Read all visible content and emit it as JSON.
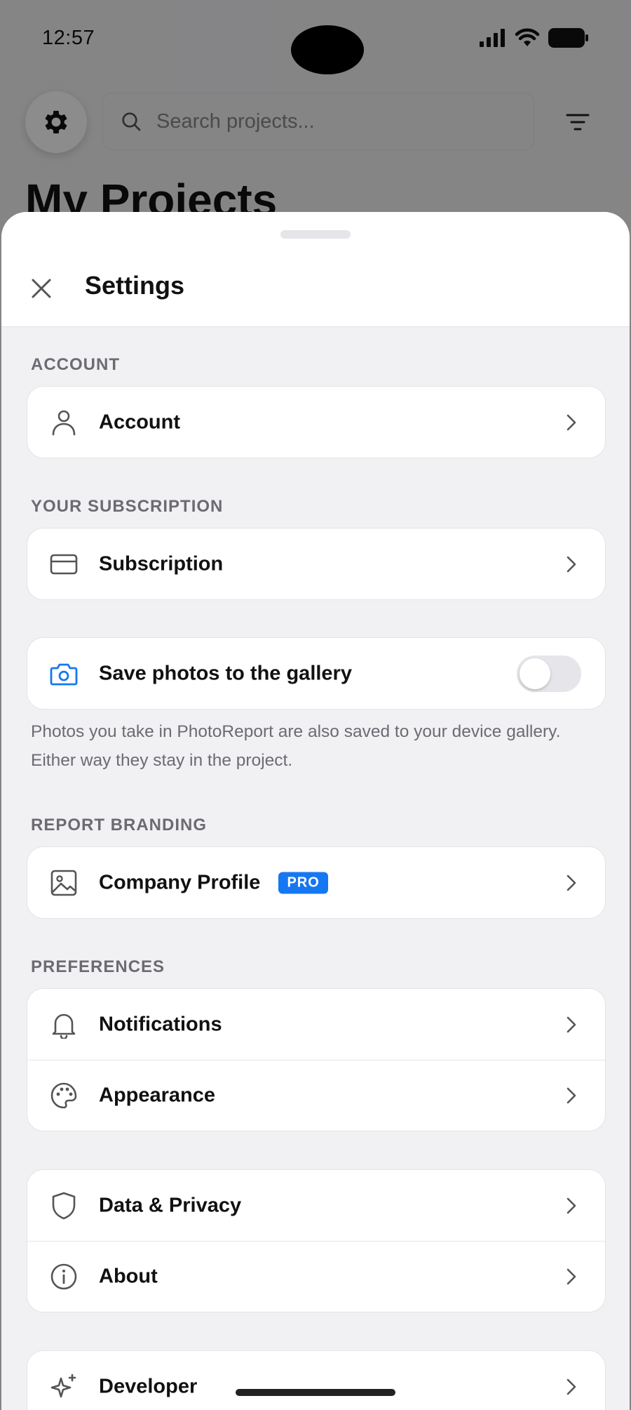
{
  "status_bar": {
    "time": "12:57"
  },
  "background": {
    "search_placeholder": "Search projects...",
    "title": "My Projects"
  },
  "sheet": {
    "title": "Settings",
    "sections": {
      "account_label": "ACCOUNT",
      "subscription_label": "YOUR SUBSCRIPTION",
      "branding_label": "REPORT BRANDING",
      "preferences_label": "PREFERENCES"
    },
    "rows": {
      "account": "Account",
      "subscription": "Subscription",
      "save_photos": "Save photos to the gallery",
      "company_profile": "Company Profile",
      "pro_badge": "PRO",
      "notifications": "Notifications",
      "appearance": "Appearance",
      "data_privacy": "Data & Privacy",
      "about": "About",
      "developer": "Developer"
    },
    "save_photos_enabled": false,
    "save_photos_helper": "Photos you take in PhotoReport are also saved to your device gallery. Either way they stay in the project."
  },
  "colors": {
    "accent": "#1677f2",
    "toggle_off": "#e6e6ea"
  }
}
